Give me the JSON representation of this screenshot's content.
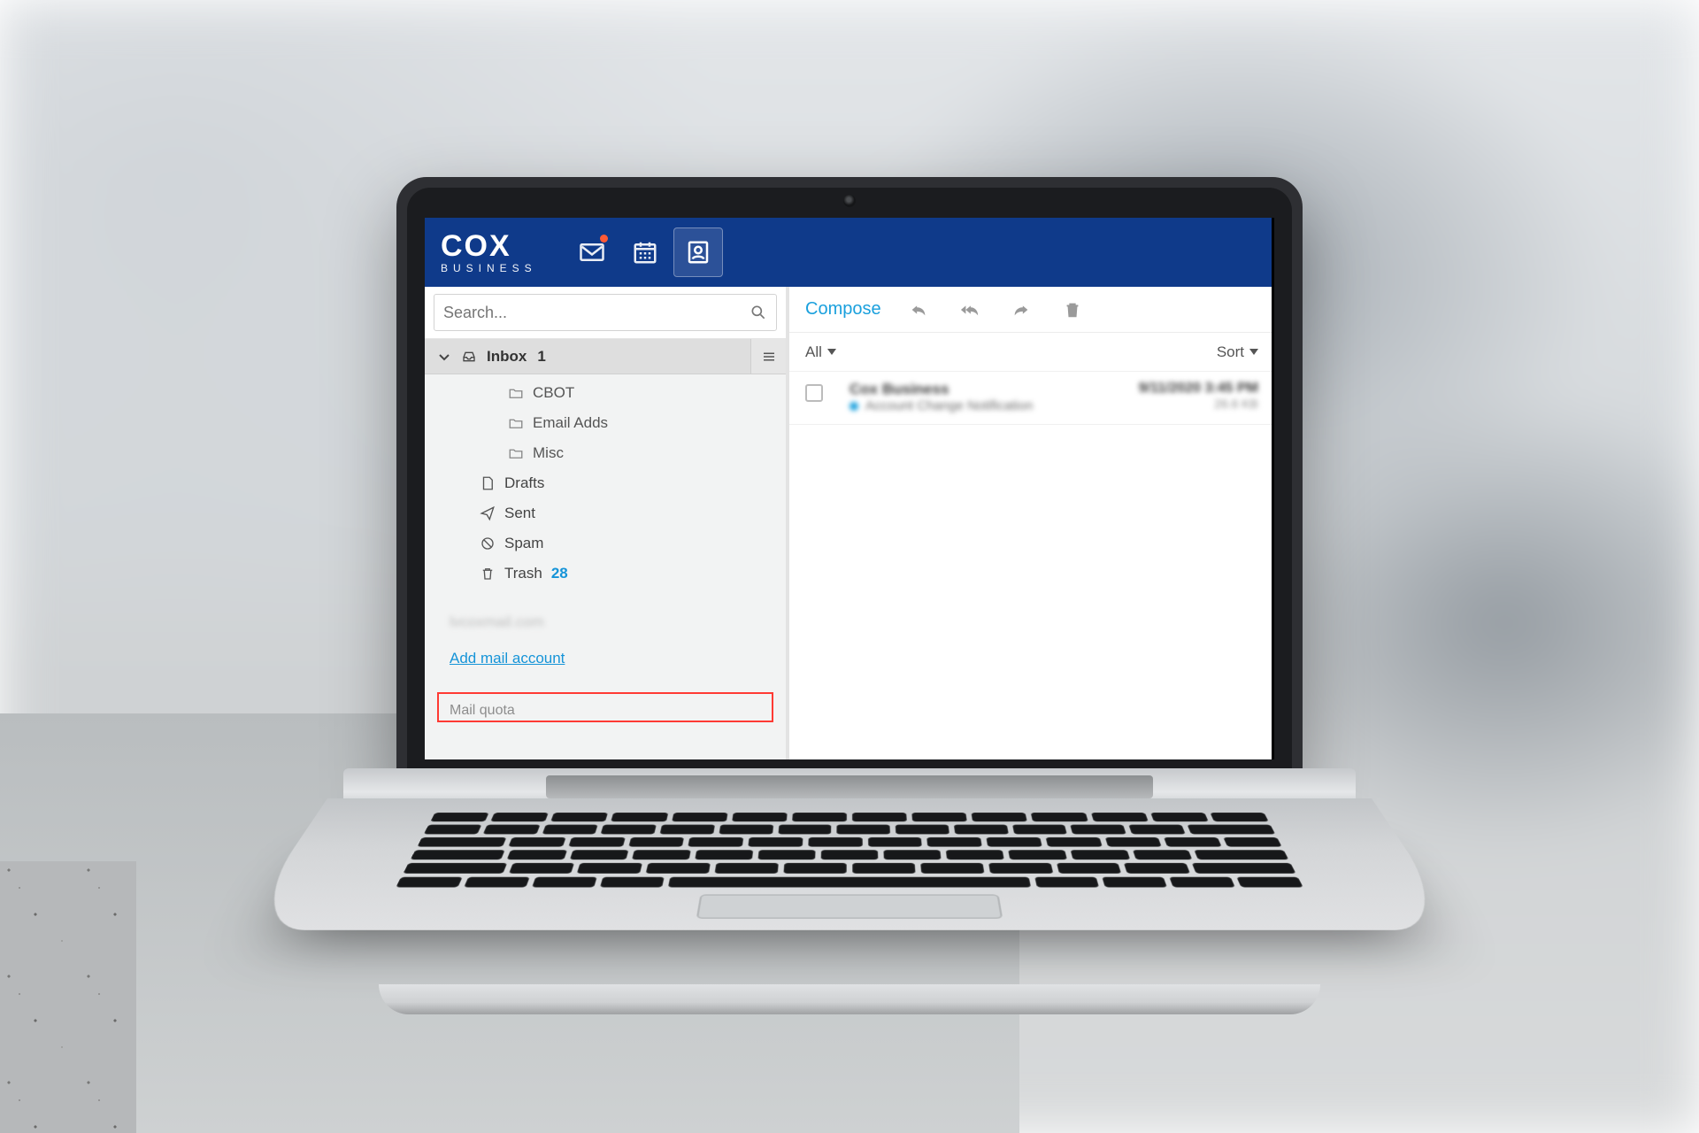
{
  "brand": {
    "name": "COX",
    "subname": "BUSINESS"
  },
  "nav": {
    "mail_notification": true,
    "active_tab": "contacts"
  },
  "search": {
    "placeholder": "Search..."
  },
  "sidebar": {
    "inbox": {
      "label": "Inbox",
      "count": "1"
    },
    "hamburger": true,
    "subfolders": [
      {
        "label": "CBOT"
      },
      {
        "label": "Email Adds"
      },
      {
        "label": "Misc"
      }
    ],
    "folders": {
      "drafts": "Drafts",
      "sent": "Sent",
      "spam": "Spam",
      "trash": {
        "label": "Trash",
        "count": "28"
      }
    },
    "account_name": "lvcoxmail.com",
    "add_account": "Add mail account",
    "mail_quota": "Mail quota"
  },
  "toolbar": {
    "compose": "Compose"
  },
  "list_header": {
    "filter": "All",
    "sort": "Sort"
  },
  "messages": [
    {
      "from": "Cox Business",
      "subject": "Account Change Notification",
      "date": "9/11/2020 3:45 PM",
      "size": "26.6 KB",
      "unread": true
    }
  ]
}
